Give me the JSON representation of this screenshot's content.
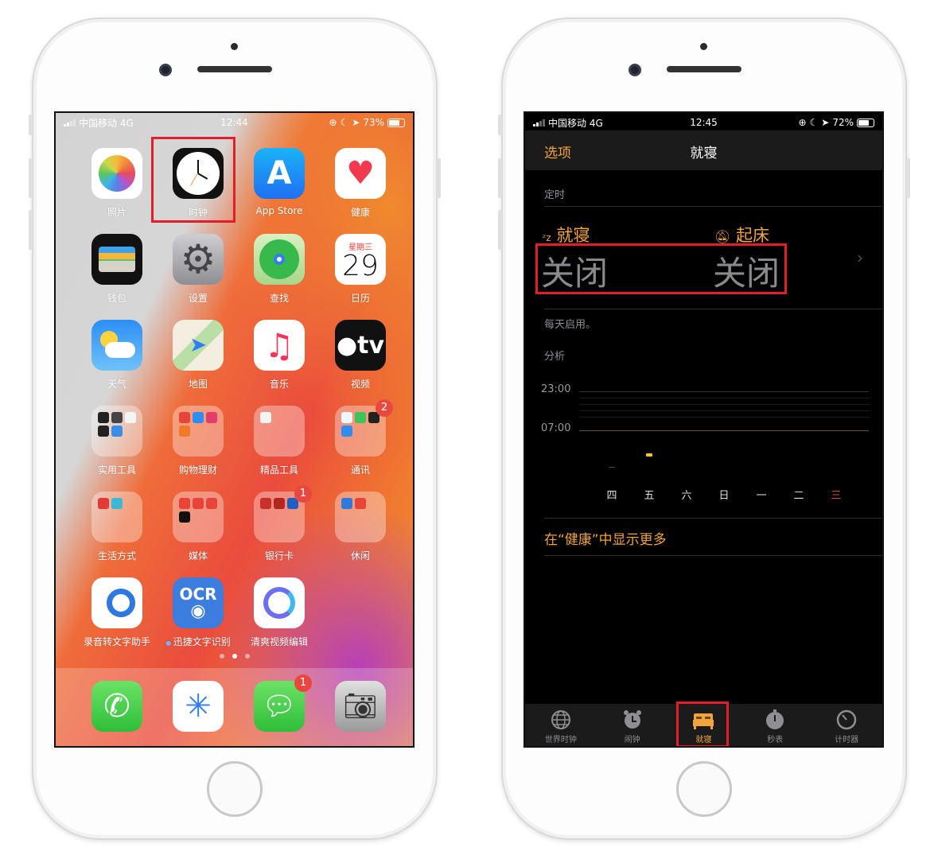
{
  "left_phone": {
    "status": {
      "carrier": "中国移动 4G",
      "time": "12:44",
      "battery": "73%",
      "battery_level": 0.73
    },
    "apps": [
      {
        "label": "照片",
        "icon": "photos-icon"
      },
      {
        "label": "时钟",
        "icon": "clock-icon",
        "highlighted": true
      },
      {
        "label": "App Store",
        "icon": "app-store-icon"
      },
      {
        "label": "健康",
        "icon": "health-icon"
      },
      {
        "label": "钱包",
        "icon": "wallet-icon"
      },
      {
        "label": "设置",
        "icon": "settings-gear-icon"
      },
      {
        "label": "查找",
        "icon": "find-my-icon"
      },
      {
        "label": "日历",
        "icon": "calendar-icon",
        "weekday": "星期三",
        "day": "29"
      },
      {
        "label": "天气",
        "icon": "weather-icon"
      },
      {
        "label": "地图",
        "icon": "maps-icon"
      },
      {
        "label": "音乐",
        "icon": "music-icon"
      },
      {
        "label": "视频",
        "icon": "apple-tv-icon",
        "text": "tv"
      },
      {
        "label": "实用工具",
        "icon": "folder-icon",
        "folder": [
          "#222",
          "#444",
          "#f5f5f5",
          "#222",
          "#3b8de8"
        ]
      },
      {
        "label": "购物理财",
        "icon": "folder-icon",
        "folder": [
          "#e8443a",
          "#2f8df0",
          "#e53d6b",
          "#f07a2a"
        ]
      },
      {
        "label": "精品工具",
        "icon": "folder-icon",
        "folder": [
          "#f4f4f4"
        ]
      },
      {
        "label": "通讯",
        "icon": "folder-icon",
        "badge": "2",
        "folder": [
          "#eef6ff",
          "#3cc35a",
          "#222",
          "#2f8df0"
        ]
      },
      {
        "label": "生活方式",
        "icon": "folder-icon",
        "folder": [
          "#e23a34",
          "#3cb8d4"
        ]
      },
      {
        "label": "媒体",
        "icon": "folder-icon",
        "folder": [
          "#e8443a",
          "#e8443a",
          "#e8443a",
          "#111"
        ]
      },
      {
        "label": "银行卡",
        "icon": "folder-icon",
        "badge": "1",
        "folder": [
          "#c9302c",
          "#b5261e",
          "#1f5fbf"
        ]
      },
      {
        "label": "休闲",
        "icon": "folder-icon",
        "folder": [
          "#2f78e0",
          "#e8443a"
        ]
      },
      {
        "label": "录音转文字助手",
        "icon": "voice-to-text-icon"
      },
      {
        "label": "迅捷文字识别",
        "icon": "ocr-icon",
        "text": "OCR",
        "new_dot": true
      },
      {
        "label": "清爽视频编辑",
        "icon": "video-editor-icon"
      }
    ],
    "page_dots": {
      "count": 3,
      "active": 1
    },
    "dock": [
      {
        "icon": "phone-icon"
      },
      {
        "icon": "safari-icon"
      },
      {
        "icon": "messages-icon",
        "badge": "1"
      },
      {
        "icon": "camera-icon"
      }
    ]
  },
  "right_phone": {
    "status": {
      "carrier": "中国移动 4G",
      "time": "12:45",
      "battery": "72%",
      "battery_level": 0.72
    },
    "nav": {
      "left": "选项",
      "title": "就寝"
    },
    "schedule_header": "定时",
    "bedtime": {
      "label": "就寝",
      "value": "关闭"
    },
    "wake": {
      "label": "起床",
      "value": "关闭"
    },
    "daily_note": "每天启用。",
    "analysis_header": "分析",
    "chart": {
      "y_ticks": [
        "23:00",
        "07:00"
      ],
      "days": [
        "四",
        "五",
        "六",
        "日",
        "一",
        "二",
        "三"
      ],
      "today_index": 6
    },
    "health_link": "在“健康”中显示更多",
    "tabs": [
      {
        "label": "世界时钟",
        "icon": "globe-icon"
      },
      {
        "label": "闹钟",
        "icon": "alarm-clock-icon"
      },
      {
        "label": "就寝",
        "icon": "bed-icon",
        "active": true
      },
      {
        "label": "秒表",
        "icon": "stopwatch-icon"
      },
      {
        "label": "计时器",
        "icon": "timer-icon"
      }
    ]
  },
  "colors": {
    "accent": "#f2a33a",
    "highlight_box": "#e21f26",
    "badge": "#e9483f",
    "today": "#e0443a"
  }
}
